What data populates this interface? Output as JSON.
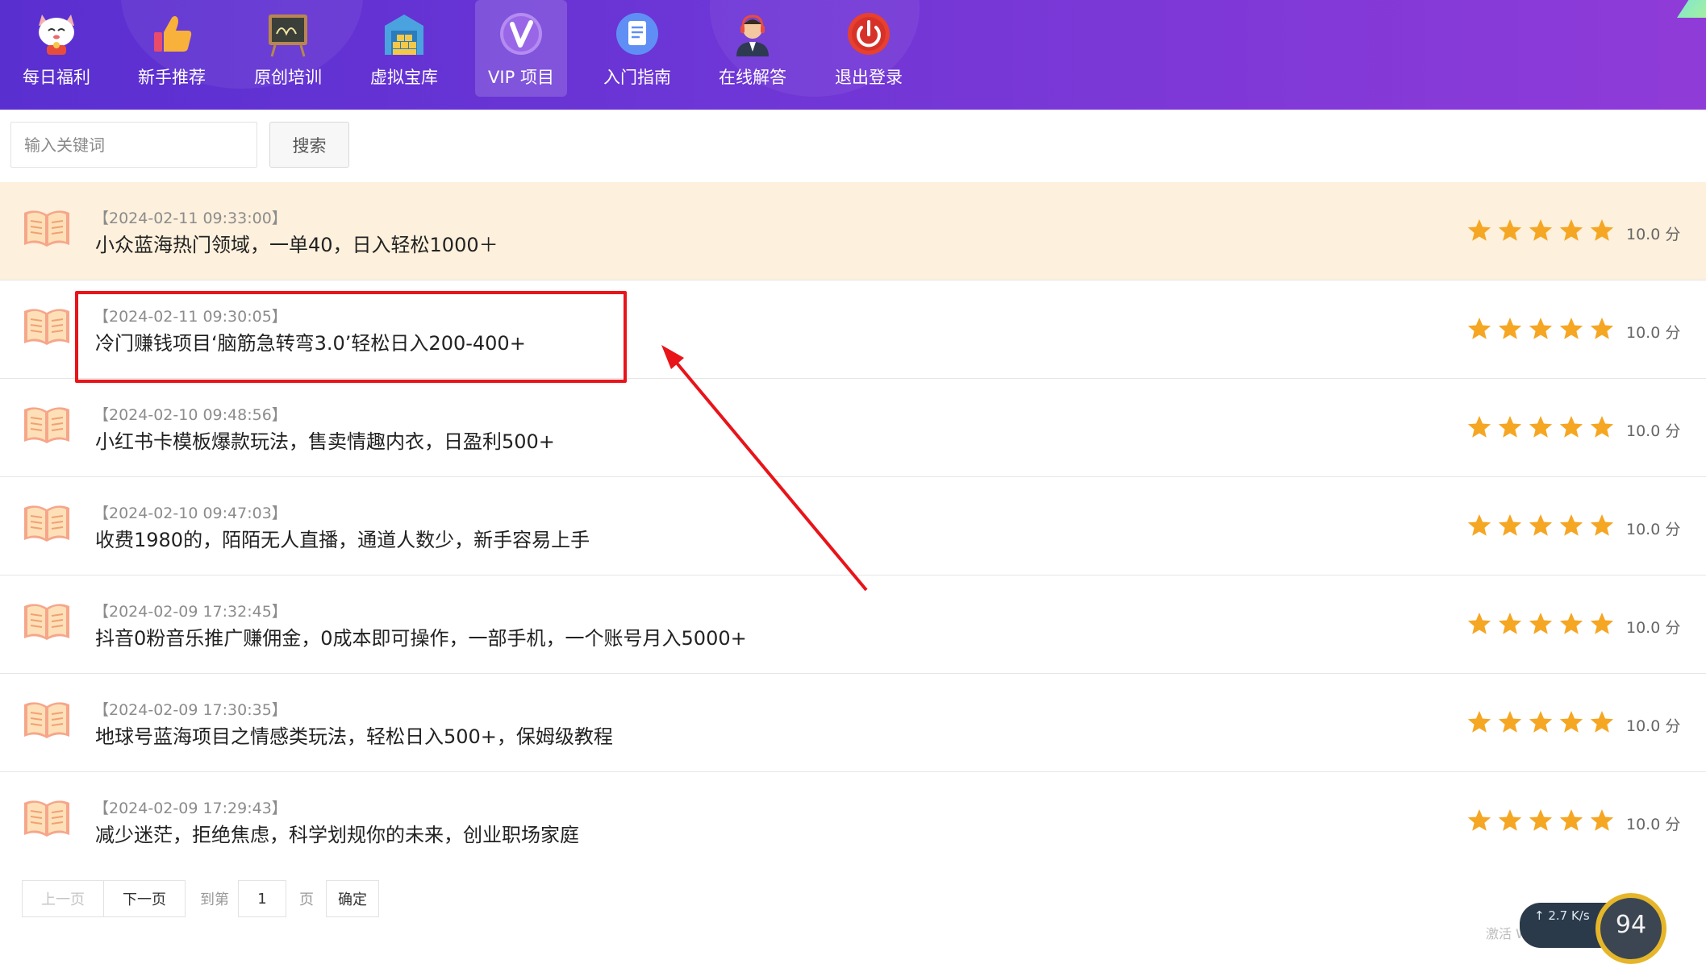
{
  "nav": {
    "items": [
      {
        "label": "每日福利",
        "icon": "lucky-cat-icon"
      },
      {
        "label": "新手推荐",
        "icon": "thumbs-up-icon"
      },
      {
        "label": "原创培训",
        "icon": "chalkboard-icon"
      },
      {
        "label": "虚拟宝库",
        "icon": "warehouse-icon"
      },
      {
        "label": "VIP 项目",
        "icon": "vip-badge-icon",
        "active": true
      },
      {
        "label": "入门指南",
        "icon": "document-icon"
      },
      {
        "label": "在线解答",
        "icon": "support-agent-icon"
      },
      {
        "label": "退出登录",
        "icon": "power-icon"
      }
    ]
  },
  "search": {
    "placeholder": "输入关键词",
    "value": "",
    "button_label": "搜索"
  },
  "list": {
    "items": [
      {
        "date": "【2024-02-11 09:33:00】",
        "title": "小众蓝海热门领域，一单40，日入轻松1000＋",
        "stars": 5,
        "score": "10.0 分",
        "highlighted": true
      },
      {
        "date": "【2024-02-11 09:30:05】",
        "title": "冷门赚钱项目‘脑筋急转弯3.0’轻松日入200-400+",
        "stars": 5,
        "score": "10.0 分"
      },
      {
        "date": "【2024-02-10 09:48:56】",
        "title": "小红书卡模板爆款玩法，售卖情趣内衣，日盈利500+",
        "stars": 5,
        "score": "10.0 分"
      },
      {
        "date": "【2024-02-10 09:47:03】",
        "title": "收费1980的，陌陌无人直播，通道人数少，新手容易上手",
        "stars": 5,
        "score": "10.0 分"
      },
      {
        "date": "【2024-02-09 17:32:45】",
        "title": "抖音0粉音乐推广赚佣金，0成本即可操作，一部手机，一个账号月入5000+",
        "stars": 5,
        "score": "10.0 分"
      },
      {
        "date": "【2024-02-09 17:30:35】",
        "title": "地球号蓝海项目之情感类玩法，轻松日入500+，保姆级教程",
        "stars": 5,
        "score": "10.0 分"
      },
      {
        "date": "【2024-02-09 17:29:43】",
        "title": "减少迷茫，拒绝焦虑，科学划规你的未来，创业职场家庭",
        "stars": 5,
        "score": "10.0 分"
      }
    ]
  },
  "pagination": {
    "prev_label": "上一页",
    "next_label": "下一页",
    "goto_label": "到第",
    "page_value": "1",
    "page_suffix": "页",
    "confirm_label": "确定"
  },
  "widget": {
    "speed": "↑ 2.7 K/s",
    "gauge": "94",
    "watermark": "激活 Window"
  },
  "colors": {
    "nav_gradient_start": "#5a2fd0",
    "nav_gradient_end": "#8f3bd8",
    "highlight_row": "#fdf0dc",
    "star": "#f5a623",
    "annotation": "#e8141a"
  }
}
